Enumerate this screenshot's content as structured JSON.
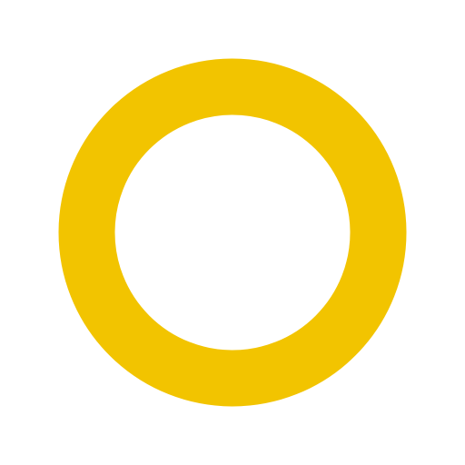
{
  "icon": {
    "name": "ring-icon",
    "shape": "circle-outline",
    "color": "#F2C400",
    "background": "#FFFFFF"
  }
}
